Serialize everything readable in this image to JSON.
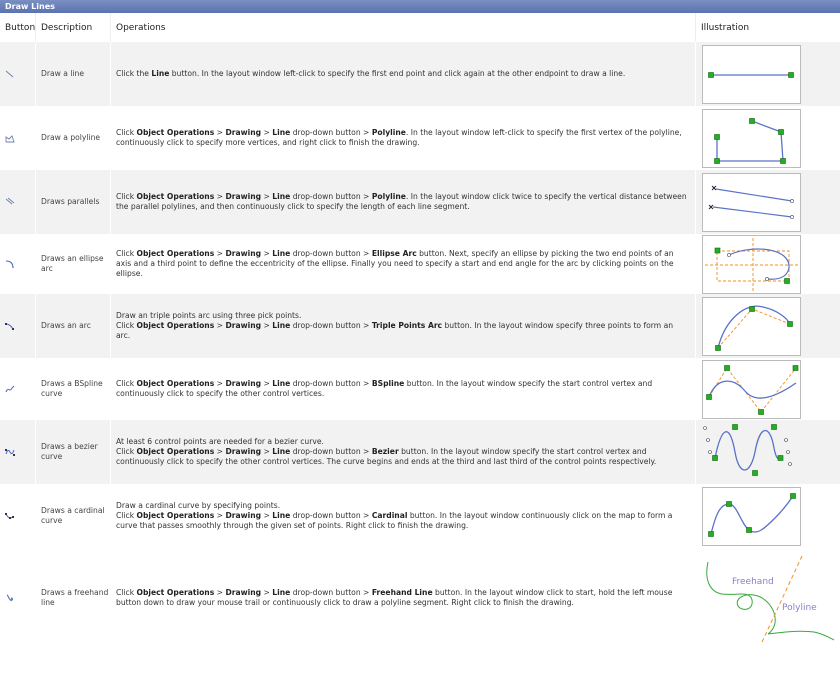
{
  "title": "Draw Lines",
  "headers": {
    "button": "Button",
    "description": "Description",
    "operations": "Operations",
    "illustration": "Illustration"
  },
  "rows": [
    {
      "icon": "line-icon",
      "description": "Draw a line",
      "ops": [
        [
          "t",
          "Click the "
        ],
        [
          "b",
          "Line"
        ],
        [
          "t",
          " button. In the layout window left-click to specify the first end point and click again at the other endpoint to draw a line."
        ]
      ]
    },
    {
      "icon": "polyline-icon",
      "description": "Draw a polyline",
      "ops": [
        [
          "t",
          "Click "
        ],
        [
          "b",
          "Object Operations"
        ],
        [
          "t",
          " > "
        ],
        [
          "b",
          "Drawing"
        ],
        [
          "t",
          " > "
        ],
        [
          "b",
          "Line"
        ],
        [
          "t",
          " drop-down button > "
        ],
        [
          "b",
          "Polyline"
        ],
        [
          "t",
          ". In the layout window left-click to specify the first vertex of the polyline, continuously click to specify more vertices, and right click to finish the drawing."
        ]
      ]
    },
    {
      "icon": "parallels-icon",
      "description": "Draws parallels",
      "ops": [
        [
          "t",
          "Click "
        ],
        [
          "b",
          "Object Operations"
        ],
        [
          "t",
          " > "
        ],
        [
          "b",
          "Drawing"
        ],
        [
          "t",
          " > "
        ],
        [
          "b",
          "Line"
        ],
        [
          "t",
          " drop-down button > "
        ],
        [
          "b",
          "Polyline"
        ],
        [
          "t",
          ". In the layout window click twice to specify the vertical distance between the parallel polylines, and then continuously click to specify the length of each line segment."
        ]
      ]
    },
    {
      "icon": "ellipse-arc-icon",
      "description": "Draws an ellipse arc",
      "ops": [
        [
          "t",
          "Click "
        ],
        [
          "b",
          "Object Operations"
        ],
        [
          "t",
          " > "
        ],
        [
          "b",
          "Drawing"
        ],
        [
          "t",
          " > "
        ],
        [
          "b",
          "Line"
        ],
        [
          "t",
          " drop-down button > "
        ],
        [
          "b",
          "Ellipse Arc"
        ],
        [
          "t",
          " button. Next, specify an ellipse by picking the two end points of an axis and a third point to define the eccentricity of the ellipse. Finally you need to specify a start and end angle for the arc by clicking points on the ellipse."
        ]
      ]
    },
    {
      "icon": "arc-icon",
      "description": "Draws an arc",
      "ops": [
        [
          "t",
          "Draw an triple points arc using three pick points."
        ],
        [
          "br",
          ""
        ],
        [
          "t",
          "Click "
        ],
        [
          "b",
          "Object Operations"
        ],
        [
          "t",
          " > "
        ],
        [
          "b",
          "Drawing"
        ],
        [
          "t",
          " > "
        ],
        [
          "b",
          "Line"
        ],
        [
          "t",
          " drop-down button > "
        ],
        [
          "b",
          "Triple Points Arc"
        ],
        [
          "t",
          " button. In the layout window specify three points to form an arc."
        ]
      ]
    },
    {
      "icon": "bspline-icon",
      "description": "Draws a BSpline curve",
      "ops": [
        [
          "t",
          "Click "
        ],
        [
          "b",
          "Object Operations"
        ],
        [
          "t",
          " > "
        ],
        [
          "b",
          "Drawing"
        ],
        [
          "t",
          " > "
        ],
        [
          "b",
          "Line"
        ],
        [
          "t",
          " drop-down button > "
        ],
        [
          "b",
          "BSpline"
        ],
        [
          "t",
          " button. In the layout window specify the start control vertex and continuously click to specify the other control vertices."
        ]
      ]
    },
    {
      "icon": "bezier-icon",
      "description": "Draws a bezier curve",
      "ops": [
        [
          "t",
          "At least 6 control points are needed for a bezier curve."
        ],
        [
          "br",
          ""
        ],
        [
          "t",
          "Click "
        ],
        [
          "b",
          "Object Operations"
        ],
        [
          "t",
          " > "
        ],
        [
          "b",
          "Drawing"
        ],
        [
          "t",
          " > "
        ],
        [
          "b",
          "Line"
        ],
        [
          "t",
          " drop-down button > "
        ],
        [
          "b",
          "Bezier"
        ],
        [
          "t",
          " button. In the layout window specify the start control vertex and continuously click to specify the other control vertices. The curve begins and ends at the third and last third of the control points respectively."
        ]
      ]
    },
    {
      "icon": "cardinal-icon",
      "description": "Draws a cardinal curve",
      "ops": [
        [
          "t",
          "Draw a cardinal curve by specifying points."
        ],
        [
          "br",
          ""
        ],
        [
          "t",
          "Click "
        ],
        [
          "b",
          "Object Operations"
        ],
        [
          "t",
          " > "
        ],
        [
          "b",
          "Drawing"
        ],
        [
          "t",
          " > "
        ],
        [
          "b",
          "Line"
        ],
        [
          "t",
          " drop-down button > "
        ],
        [
          "b",
          "Cardinal"
        ],
        [
          "t",
          " button. In the layout window continuously click on the map to form a curve that passes smoothly through the given set of points. Right click to finish the drawing."
        ]
      ]
    },
    {
      "icon": "freehand-icon",
      "description": "Draws a freehand line",
      "ops": [
        [
          "t",
          "Click "
        ],
        [
          "b",
          "Object Operations"
        ],
        [
          "t",
          " > "
        ],
        [
          "b",
          "Drawing"
        ],
        [
          "t",
          " > "
        ],
        [
          "b",
          "Line"
        ],
        [
          "t",
          " drop-down button > "
        ],
        [
          "b",
          "Freehand Line"
        ],
        [
          "t",
          " button. In the layout window click to start, hold the left mouse button down to draw your mouse trail or continuously click to draw a polyline segment. Right click to finish the drawing."
        ]
      ]
    }
  ],
  "illustration_labels": {
    "freehand": "Freehand",
    "polyline": "Polyline"
  },
  "colors": {
    "title_bar": "#5a72b0",
    "line": "#5a72c8",
    "vertex": "#22b022",
    "guide": "#f09020",
    "freehand": "#3aaa3a"
  }
}
